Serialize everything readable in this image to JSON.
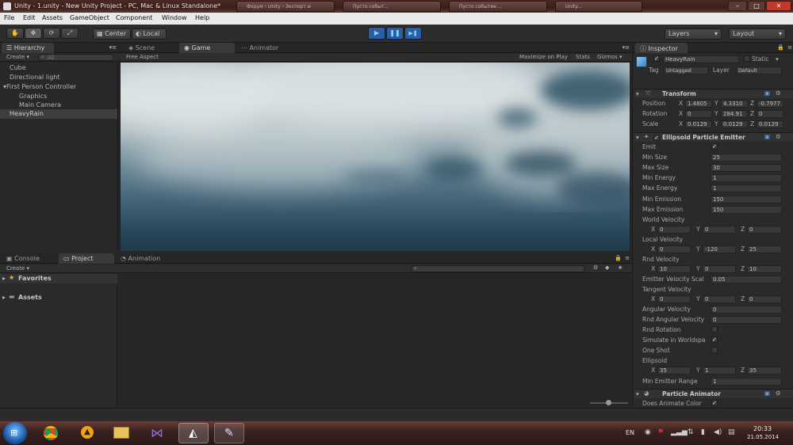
{
  "window": {
    "title": "Unity - 1.unity - New Unity Project - PC, Mac & Linux Standalone*",
    "bg_tabs": [
      "Форум › Unity › Экспорт и",
      "Пусто событ...",
      "Пусто событие ...",
      "Unity..."
    ],
    "controls": {
      "minimize": "–",
      "maximize": "□",
      "close": "✕"
    }
  },
  "menubar": {
    "items": [
      "File",
      "Edit",
      "Assets",
      "GameObject",
      "Component",
      "Window",
      "Help"
    ]
  },
  "toolbar": {
    "tools": [
      "hand-icon",
      "move-icon",
      "rotate-icon",
      "scale-icon"
    ],
    "pivot": "Center",
    "space": "Local",
    "play": "▶",
    "pause": "❚❚",
    "step": "▶❚",
    "layers": "Layers",
    "layout": "Layout"
  },
  "hierarchy": {
    "tab": "Hierarchy",
    "create": "Create ▾",
    "search_placeholder": "All",
    "items": [
      {
        "label": "Cube"
      },
      {
        "label": "Directional light"
      },
      {
        "label": "First Person Controller"
      },
      {
        "label": "Graphics"
      },
      {
        "label": "Main Camera"
      },
      {
        "label": "HeavyRain"
      }
    ]
  },
  "scene": {
    "tabs": [
      "Scene",
      "Game",
      "Animator"
    ],
    "aspect": "Free Aspect",
    "maximize": "Maximize on Play",
    "stats": "Stats",
    "gizmos": "Gizmos ▾"
  },
  "bottom": {
    "tabs": [
      "Console",
      "Project",
      "Animation"
    ],
    "create": "Create ▾",
    "favorites": "Favorites",
    "assets": "Assets"
  },
  "inspector": {
    "tab": "Inspector",
    "object_name": "HeavyRain",
    "static": "Static",
    "tag_label": "Tag",
    "tag_value": "Untagged",
    "layer_label": "Layer",
    "layer_value": "Default",
    "transform": {
      "title": "Transform",
      "position_label": "Position",
      "rotation_label": "Rotation",
      "scale_label": "Scale",
      "position": [
        "1.4805",
        "4.3310",
        "-0.7977"
      ],
      "rotation": [
        "0",
        "284.91",
        "0"
      ],
      "scale": [
        "0.0129",
        "0.0129",
        "0.0129"
      ]
    },
    "emitter": {
      "title": "Ellipsoid Particle Emitter",
      "emit": "Emit",
      "min_size": {
        "label": "Min Size",
        "value": "25"
      },
      "max_size": {
        "label": "Max Size",
        "value": "30"
      },
      "min_energy": {
        "label": "Min Energy",
        "value": "1"
      },
      "max_energy": {
        "label": "Max Energy",
        "value": "1"
      },
      "min_emission": {
        "label": "Min Emission",
        "value": "150"
      },
      "max_emission": {
        "label": "Max Emission",
        "value": "150"
      },
      "world_velocity": {
        "label": "World Velocity",
        "xyz": [
          "0",
          "0",
          "0"
        ]
      },
      "local_velocity": {
        "label": "Local Velocity",
        "xyz": [
          "0",
          "-120",
          "25"
        ]
      },
      "rnd_velocity": {
        "label": "Rnd Velocity",
        "xyz": [
          "10",
          "0",
          "10"
        ]
      },
      "emitter_velocity_scale": {
        "label": "Emitter Velocity Scal",
        "value": "0.05"
      },
      "tangent_velocity": {
        "label": "Tangent Velocity",
        "xyz": [
          "0",
          "0",
          "0"
        ]
      },
      "angular_velocity": {
        "label": "Angular Velocity",
        "value": "0"
      },
      "rnd_angular_velocity": {
        "label": "Rnd Angular Velocity",
        "value": "0"
      },
      "rnd_rotation": "Rnd Rotation",
      "simulate_worldspace": "Simulate in Worldspa",
      "one_shot": "One Shot",
      "ellipsoid": {
        "label": "Ellipsoid",
        "xyz": [
          "35",
          "1",
          "35"
        ]
      },
      "min_emitter_range": {
        "label": "Min Emitter Range",
        "value": "1"
      }
    },
    "animator": {
      "title": "Particle Animator",
      "does_animate_color": "Does Animate Color"
    },
    "axis": {
      "x": "X",
      "y": "Y",
      "z": "Z"
    }
  },
  "taskbar": {
    "lang": "EN",
    "time": "20:33",
    "date": "21.05.2014"
  },
  "colors": {
    "play_active": "#2a5fa8",
    "panel_bg": "#282828",
    "sky_top": "#b9c7cc",
    "sky_bottom": "#1f3a4a"
  }
}
